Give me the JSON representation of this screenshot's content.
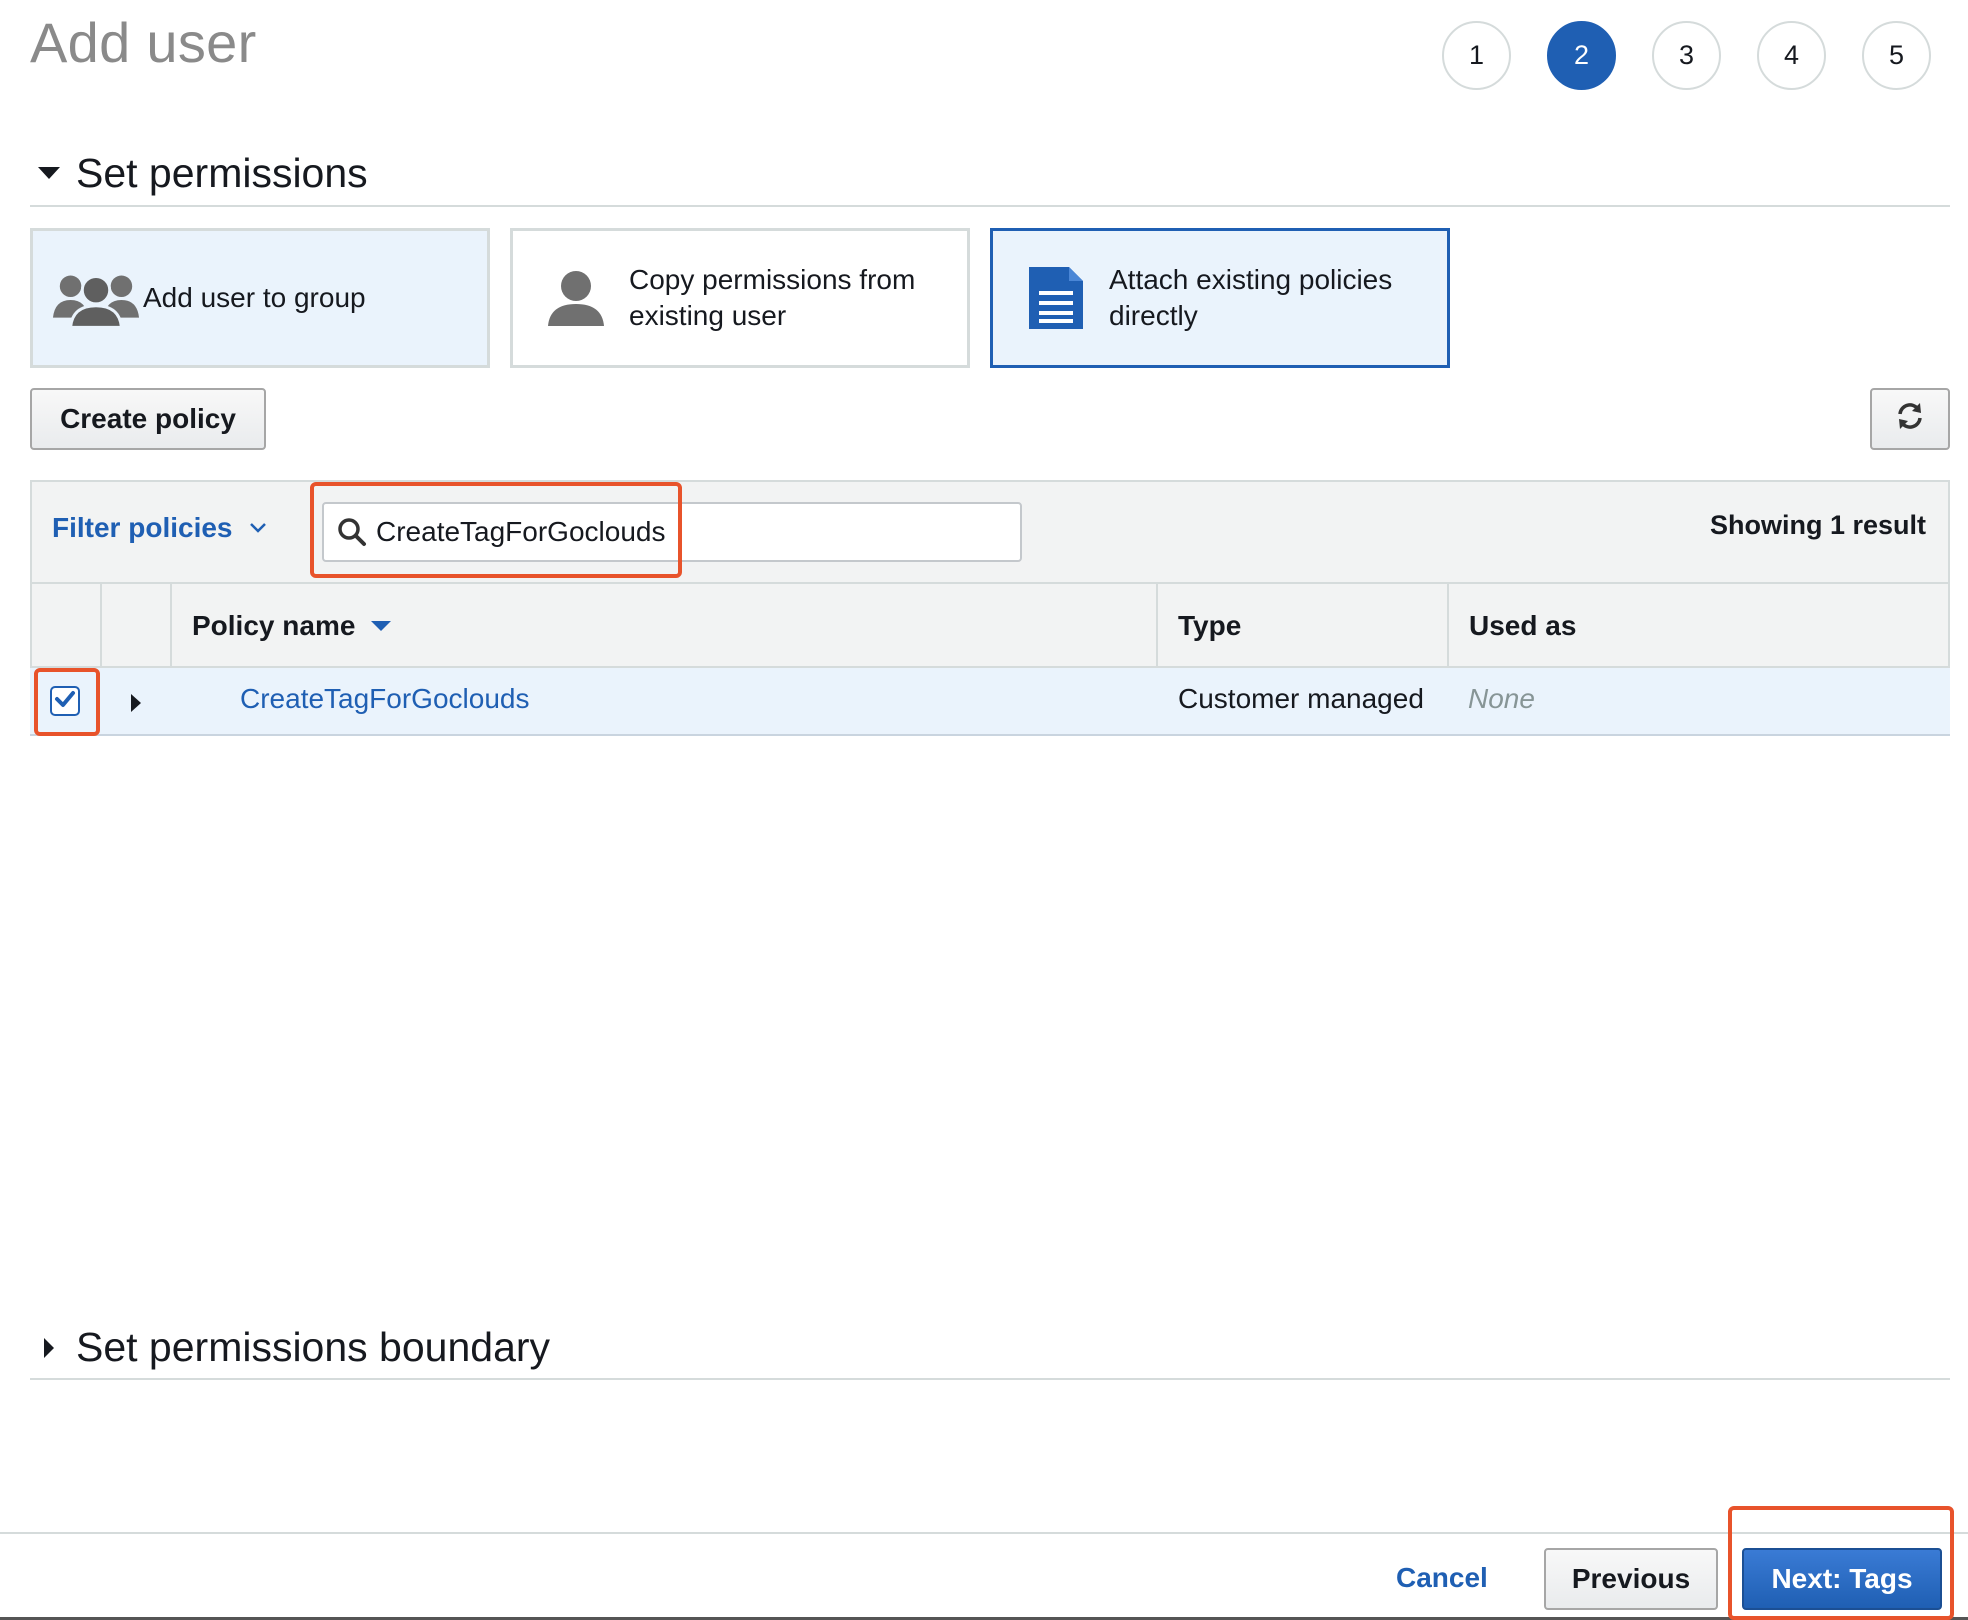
{
  "header": {
    "title": "Add user"
  },
  "steps": [
    "1",
    "2",
    "3",
    "4",
    "5"
  ],
  "sections": {
    "permissions": "Set permissions",
    "boundary": "Set permissions boundary"
  },
  "options": {
    "group": "Add user to group",
    "copy_line1": "Copy permissions from",
    "copy_line2": "existing user",
    "attach_line1": "Attach existing policies",
    "attach_line2": "directly"
  },
  "toolbar": {
    "create_policy": "Create policy",
    "filter_label": "Filter policies",
    "search_value": "CreateTagForGoclouds",
    "result_count": "Showing 1 result"
  },
  "table": {
    "columns": {
      "policy_name": "Policy name",
      "type": "Type",
      "used_as": "Used as"
    },
    "rows": [
      {
        "name": "CreateTagForGoclouds",
        "type": "Customer managed",
        "used_as": "None",
        "checked": true
      }
    ]
  },
  "footer": {
    "cancel": "Cancel",
    "previous": "Previous",
    "next": "Next: Tags"
  },
  "colors": {
    "accent": "#1f5fb3",
    "highlight": "#e8532b",
    "selected_bg": "#eaf3fc"
  }
}
